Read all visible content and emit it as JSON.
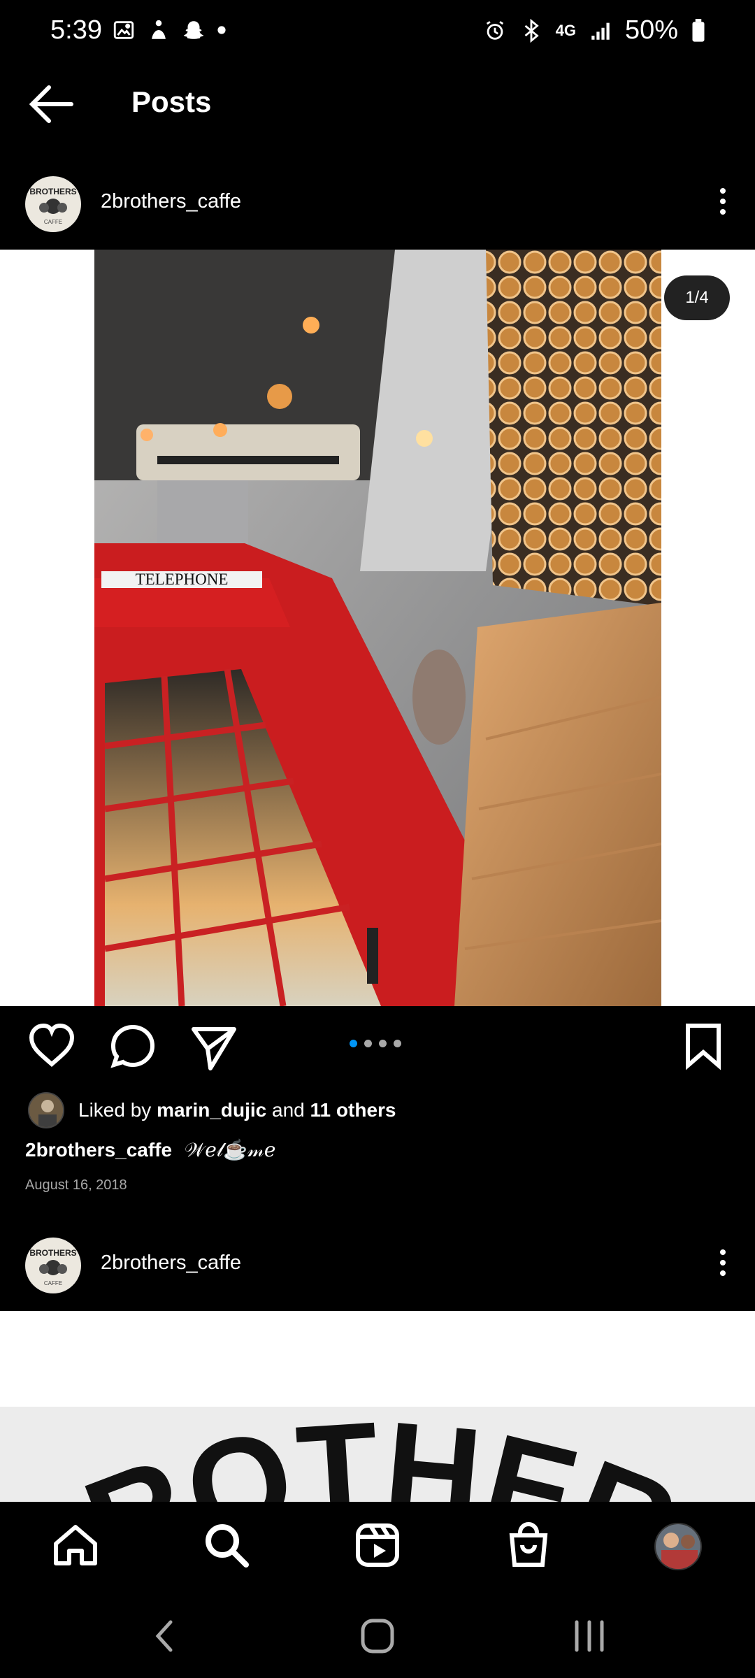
{
  "status_bar": {
    "time": "5:39",
    "network": "4G",
    "battery": "50%",
    "left_icons": [
      "gallery-icon",
      "notification-icon",
      "snapchat-icon",
      "dot-icon"
    ],
    "right_icons": [
      "alarm-icon",
      "bluetooth-icon",
      "network-icon",
      "signal-icon",
      "battery-icon"
    ]
  },
  "header": {
    "title": "Posts",
    "back_icon": "arrow-left-icon"
  },
  "post": {
    "username": "2brothers_caffe",
    "avatar_text": "BROTHERS",
    "avatar_subtext": "CAFFE",
    "image_counter": "1/4",
    "carousel_count": 4,
    "carousel_active_index": 0,
    "photo_sign_text": "TELEPHONE",
    "likes": {
      "prefix": "Liked by",
      "user": "marin_dujic",
      "middle": "and",
      "others": "11 others"
    },
    "caption_username": "2brothers_caffe",
    "caption_text": "𝒲𝑒𝓁☕𝓂𝑒",
    "date": "August 16, 2018"
  },
  "next_post": {
    "username": "2brothers_caffe",
    "avatar_text": "BROTHERS",
    "avatar_subtext": "CAFFE",
    "image_text": "BROTHERS"
  },
  "bottom_nav": {
    "items": [
      "home-icon",
      "search-icon",
      "reels-icon",
      "shop-icon",
      "profile-avatar"
    ]
  },
  "system_nav": {
    "items": [
      "back-icon",
      "home-button-icon",
      "recents-icon"
    ]
  },
  "colors": {
    "background": "#000000",
    "text": "#ffffff",
    "muted": "#a8a8a8",
    "accent": "#0095f6"
  }
}
